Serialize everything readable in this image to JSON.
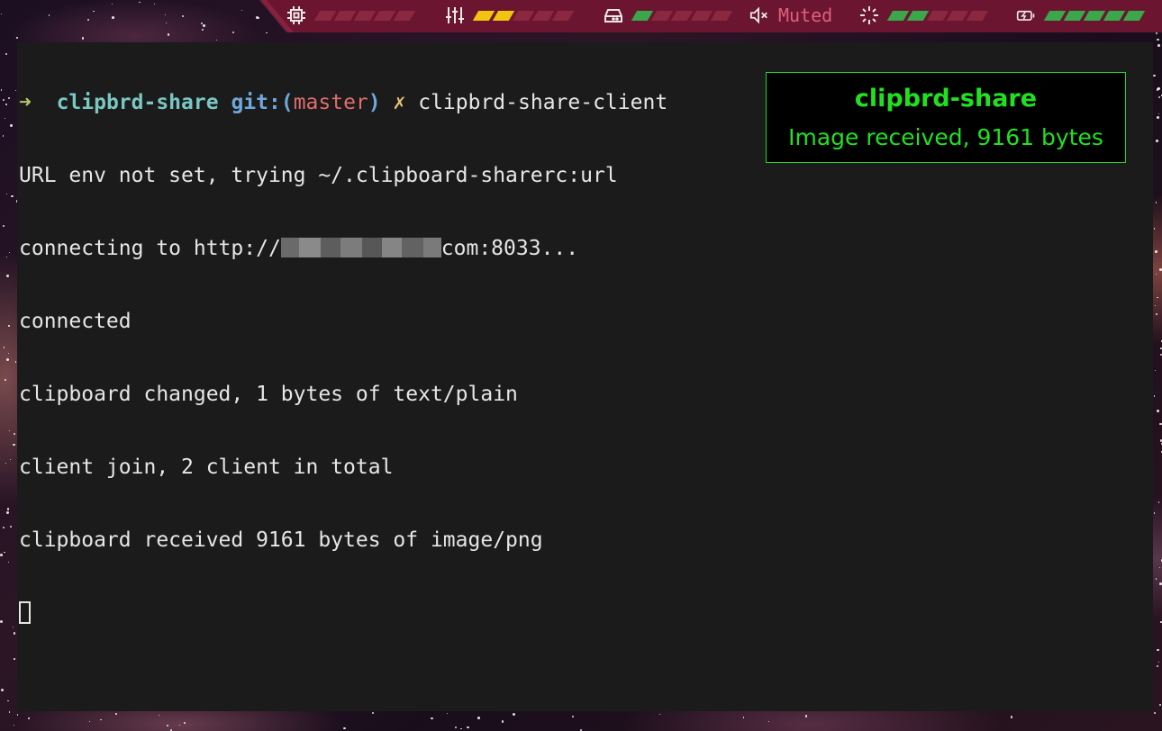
{
  "statusbar": {
    "modules": [
      {
        "icon": "cpu-icon",
        "filled": 0,
        "total": 5,
        "fill_color": "#8a2840"
      },
      {
        "icon": "sliders-icon",
        "filled": 2,
        "total": 5,
        "fill_color": "#f1c40f"
      },
      {
        "icon": "disk-icon",
        "filled": 1,
        "total": 5,
        "fill_color": "#3aa84a"
      },
      {
        "icon": "volume-muted-icon",
        "label": "Muted"
      },
      {
        "icon": "brightness-icon",
        "filled": 2,
        "total": 5,
        "fill_color": "#3aa84a"
      },
      {
        "icon": "battery-charging-icon",
        "filled": 5,
        "total": 5,
        "fill_color": "#3aa84a"
      }
    ],
    "bg_color": "#6b1530"
  },
  "terminal": {
    "prompt": {
      "arrow": "➜",
      "dir": "clipbrd-share",
      "git_prefix": "git:(",
      "branch": "master",
      "git_suffix": ")",
      "dirty_mark": "✗",
      "command": "clipbrd-share-client"
    },
    "lines": [
      "URL env not set, trying ~/.clipboard-sharerc:url",
      "connecting to http://",
      "connected",
      "clipboard changed, 1 bytes of text/plain",
      "client join, 2 client in total",
      "clipboard received 9161 bytes of image/png"
    ],
    "url_suffix": "com:8033...",
    "bg_color": "#1b1b1b",
    "fg_color": "#e6e6e6"
  },
  "notification": {
    "title": "clipbrd-share",
    "body": "Image received, 9161 bytes",
    "color": "#21e021"
  }
}
